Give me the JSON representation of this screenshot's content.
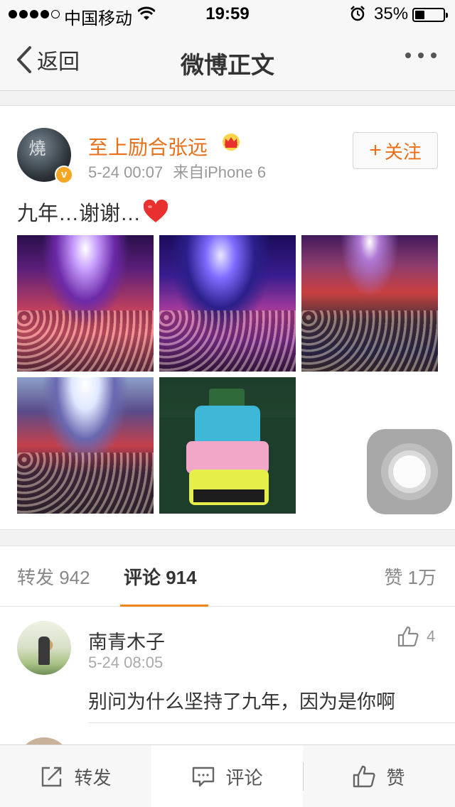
{
  "status_bar": {
    "carrier": "中国移动",
    "time": "19:59",
    "battery": "35%",
    "battery_level": 0.35
  },
  "nav": {
    "back_label": "返回",
    "title": "微博正文"
  },
  "post": {
    "author": "至上励合张远",
    "verified_mark": "v",
    "date": "5-24 00:07",
    "source": "来自iPhone 6",
    "follow_label": "关注",
    "text": "九年…谢谢…",
    "avatar_text": "燒",
    "photo_count": 5
  },
  "tabs": {
    "repost": "转发 942",
    "comment": "评论 914",
    "like": "赞 1万"
  },
  "comments": [
    {
      "author": "南青木子",
      "time": "5-24 08:05",
      "likes": "4",
      "text": "别问为什么坚持了九年，因为是你啊"
    }
  ],
  "bottom_bar": {
    "repost": "转发",
    "comment": "评论",
    "like": "赞"
  },
  "colors": {
    "accent": "#f08519",
    "author_name": "#e8701a",
    "heart": "#e8302e"
  },
  "icons": [
    "back-chevron-icon",
    "wifi-icon",
    "alarm-icon",
    "battery-icon",
    "more-icon",
    "crown-icon",
    "heart-icon",
    "thumbs-up-icon",
    "share-icon",
    "comment-icon"
  ]
}
